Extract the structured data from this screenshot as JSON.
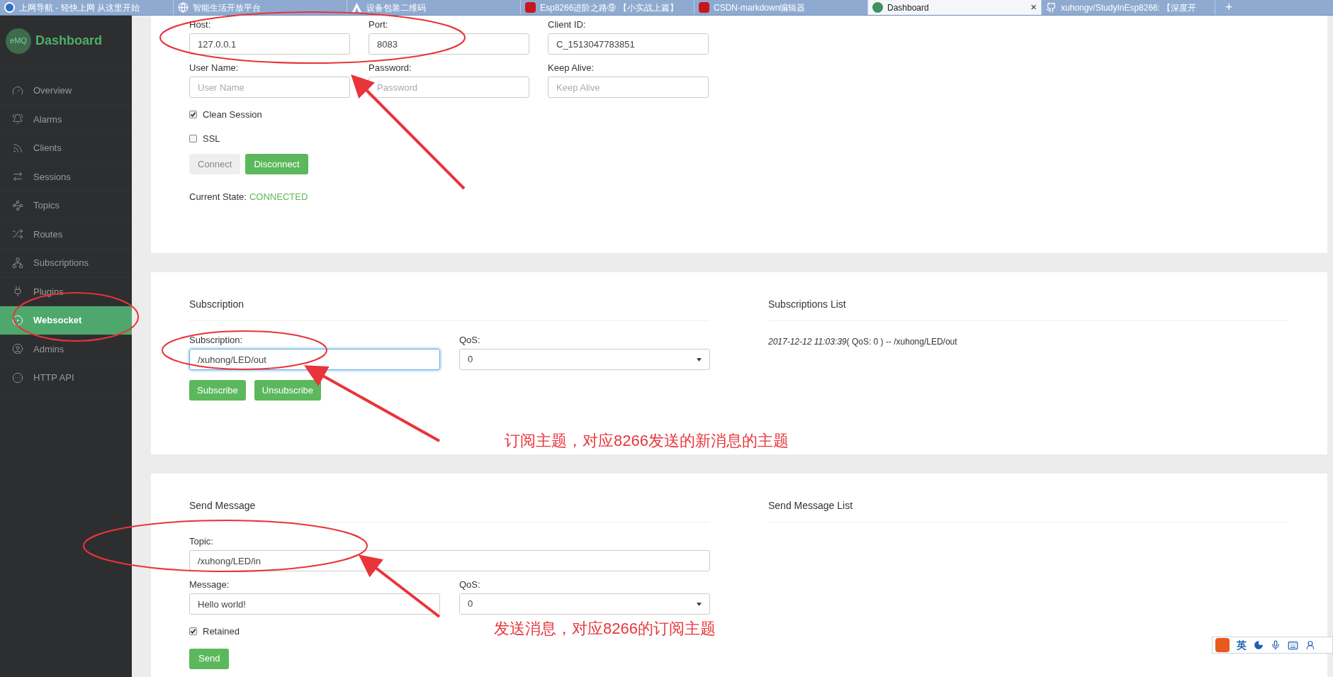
{
  "browser_tabs": [
    {
      "title": "上网导航 - 轻快上网 从这里开始",
      "selected": false
    },
    {
      "title": "智能生活开放平台",
      "selected": false
    },
    {
      "title": "设备包装二维码",
      "selected": false
    },
    {
      "title": "Esp8266进阶之路⑨ 【小实战上篇】",
      "selected": false
    },
    {
      "title": "CSDN-markdown编辑器",
      "selected": false
    },
    {
      "title": "Dashboard",
      "selected": true,
      "close": "×"
    },
    {
      "title": "xuhongv/StudyInEsp8266: 【深度开",
      "selected": false
    }
  ],
  "new_tab": "+",
  "sidebar": {
    "logo": "eMQ",
    "title": "Dashboard",
    "items": [
      {
        "label": "Overview",
        "selected": false
      },
      {
        "label": "Alarms",
        "selected": false
      },
      {
        "label": "Clients",
        "selected": false
      },
      {
        "label": "Sessions",
        "selected": false
      },
      {
        "label": "Topics",
        "selected": false
      },
      {
        "label": "Routes",
        "selected": false
      },
      {
        "label": "Subscriptions",
        "selected": false
      },
      {
        "label": "Plugins",
        "selected": false
      },
      {
        "label": "Websocket",
        "selected": true
      },
      {
        "label": "Admins",
        "selected": false
      },
      {
        "label": "HTTP API",
        "selected": false
      }
    ]
  },
  "connection": {
    "fields": [
      {
        "label": "Host:",
        "value": "127.0.0.1"
      },
      {
        "label": "Port:",
        "value": "8083"
      },
      {
        "label": "Client ID:",
        "value": "C_1513047783851"
      },
      {
        "label": "User Name:",
        "placeholder": "User Name"
      },
      {
        "label": "Password:",
        "placeholder": "Password"
      },
      {
        "label": "Keep Alive:",
        "placeholder": "Keep Alive"
      }
    ],
    "checkboxes": [
      {
        "label": "Clean Session",
        "checked": true
      },
      {
        "label": "SSL",
        "checked": false
      }
    ],
    "buttons": [
      {
        "label": "Connect",
        "disabled": true
      },
      {
        "label": "Disconnect",
        "disabled": false
      }
    ],
    "state_label": "Current State:",
    "state_value": "CONNECTED"
  },
  "subscription": {
    "title": "Subscription",
    "field": {
      "label": "Subscription:",
      "value": "/xuhong/LED/out",
      "focused": true
    },
    "qos": {
      "label": "QoS:",
      "value": "0"
    },
    "buttons": [
      "Subscribe",
      "Unsubscribe"
    ],
    "list_title": "Subscriptions List",
    "list_items": [
      "*2017-12-12 11:03:39*( QoS: 0 ) -- /xuhong/LED/out"
    ]
  },
  "send": {
    "title": "Send Message",
    "topic": {
      "label": "Topic:",
      "value": "/xuhong/LED/in"
    },
    "message": {
      "label": "Message:",
      "value": "Hello world!"
    },
    "qos": {
      "label": "QoS:",
      "value": "0"
    },
    "retained": {
      "label": "Retained",
      "checked": true
    },
    "button": "Send",
    "list_title": "Send Message List"
  },
  "annotations": [
    "订阅主题，对应8266发送的新消息的主题",
    "发送消息，对应8266的订阅主题"
  ],
  "ime_toolbar": {
    "mode": "英"
  }
}
